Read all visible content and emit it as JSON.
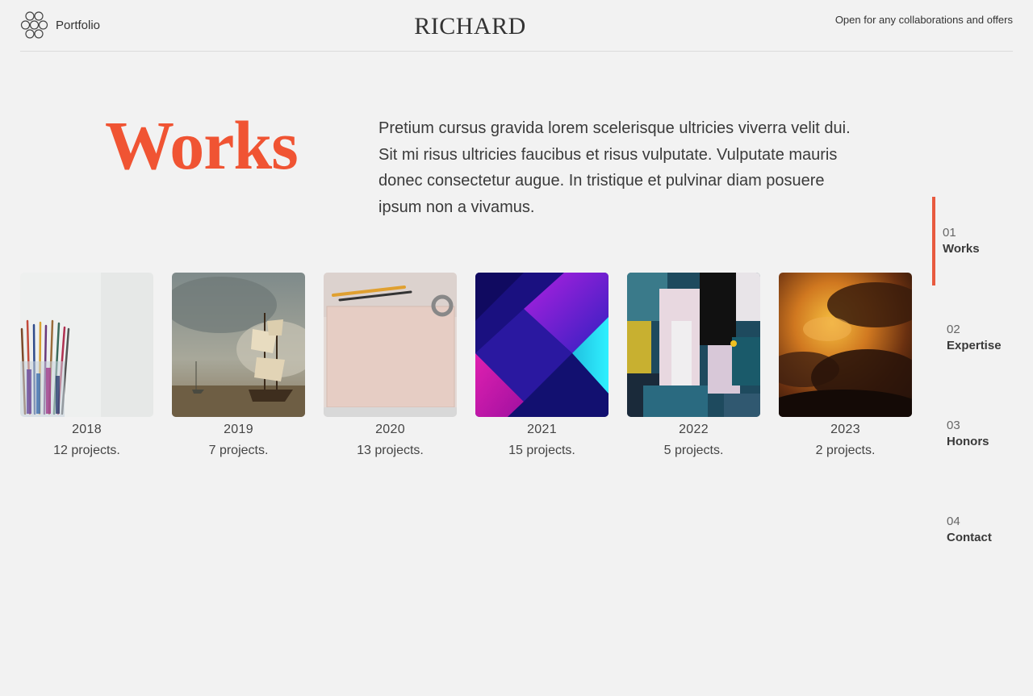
{
  "header": {
    "brand_label": "Portfolio",
    "site_title": "RICHARD",
    "tagline": "Open for any collaborations and offers"
  },
  "hero": {
    "title": "Works",
    "description": "Pretium cursus gravida lorem scelerisque ultricies viverra velit dui. Sit mi risus ultricies faucibus et risus vulputate. Vulputate mauris donec consectetur augue. In tristique et pulvinar diam posuere ipsum non a vivamus."
  },
  "gallery": [
    {
      "year": "2018",
      "count": "12 projects.",
      "image": "paint-brushes-in-jar"
    },
    {
      "year": "2019",
      "count": "7 projects.",
      "image": "sailing-ship-painting"
    },
    {
      "year": "2020",
      "count": "13 projects.",
      "image": "blank-canvas-with-pencils"
    },
    {
      "year": "2021",
      "count": "15 projects.",
      "image": "geometric-gradient-artwork"
    },
    {
      "year": "2022",
      "count": "5 projects.",
      "image": "abstract-expressionist-painting"
    },
    {
      "year": "2023",
      "count": "2 projects.",
      "image": "sunset-clouds"
    }
  ],
  "sidenav": [
    {
      "num": "01",
      "label": "Works",
      "active": true
    },
    {
      "num": "02",
      "label": "Expertise",
      "active": false
    },
    {
      "num": "03",
      "label": "Honors",
      "active": false
    },
    {
      "num": "04",
      "label": "Contact",
      "active": false
    }
  ],
  "colors": {
    "accent": "#f05433",
    "background": "#f2f2f2",
    "text": "#3a3a3a"
  },
  "icons": {
    "brand": "hexagon-cluster-icon"
  }
}
